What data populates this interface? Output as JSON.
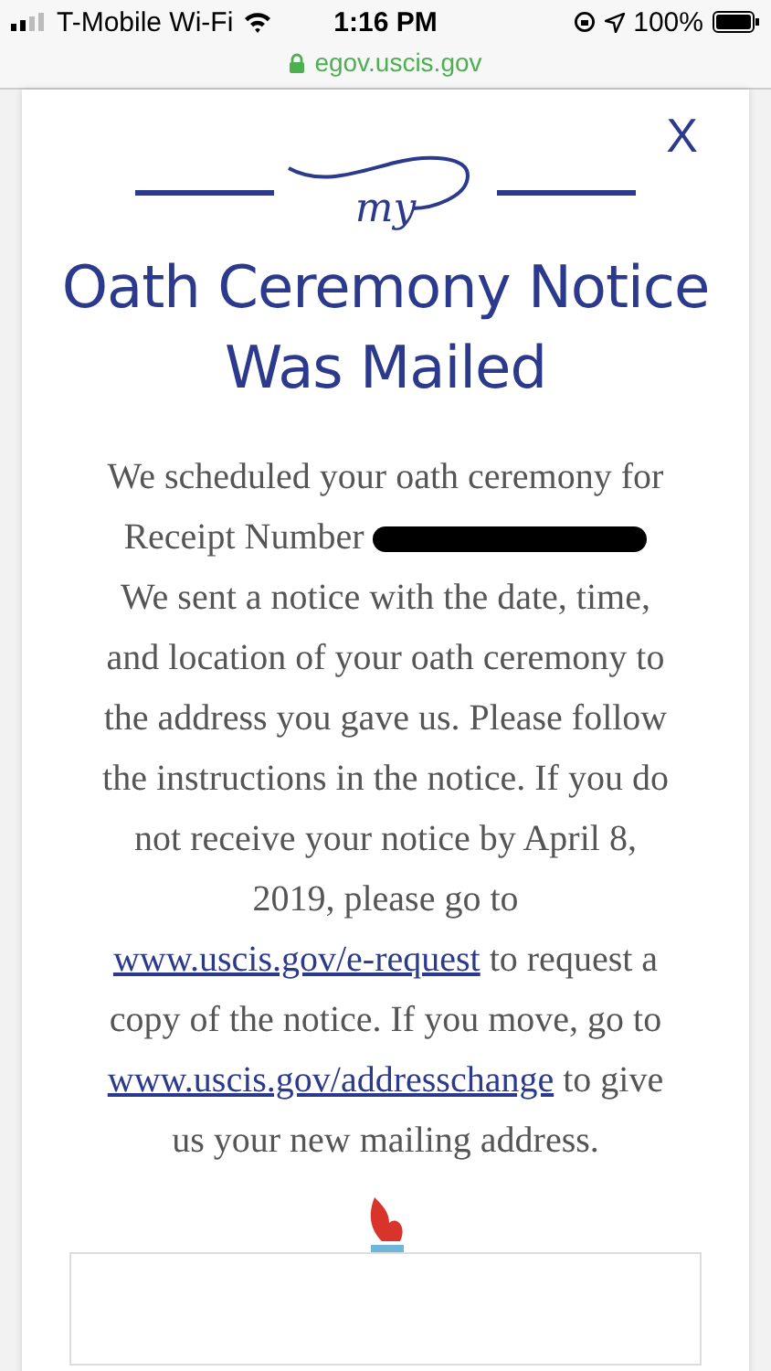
{
  "status_bar": {
    "carrier": "T-Mobile Wi-Fi",
    "time": "1:16 PM",
    "battery": "100%"
  },
  "address_bar": {
    "url": "egov.uscis.gov"
  },
  "modal": {
    "close": "X",
    "logo_text": "my",
    "title": "Oath Ceremony Notice Was Mailed",
    "message": [
      {
        "kind": "text",
        "text": "We scheduled your oath ceremony for Receipt Number "
      },
      {
        "kind": "redaction"
      },
      {
        "kind": "text",
        "text": "We sent a notice with the date, time, and location of your oath ceremony to the address you gave us. Please follow the instructions in the notice. If you do not receive your notice by April 8, 2019, please go to "
      },
      {
        "kind": "link",
        "text": "www.uscis.gov/e-request"
      },
      {
        "kind": "text",
        "text": " to request a copy of the notice. If you move, go to "
      },
      {
        "kind": "link",
        "text": "www.uscis.gov/addresschange"
      },
      {
        "kind": "text",
        "text": " to give us your new mailing address."
      }
    ]
  }
}
